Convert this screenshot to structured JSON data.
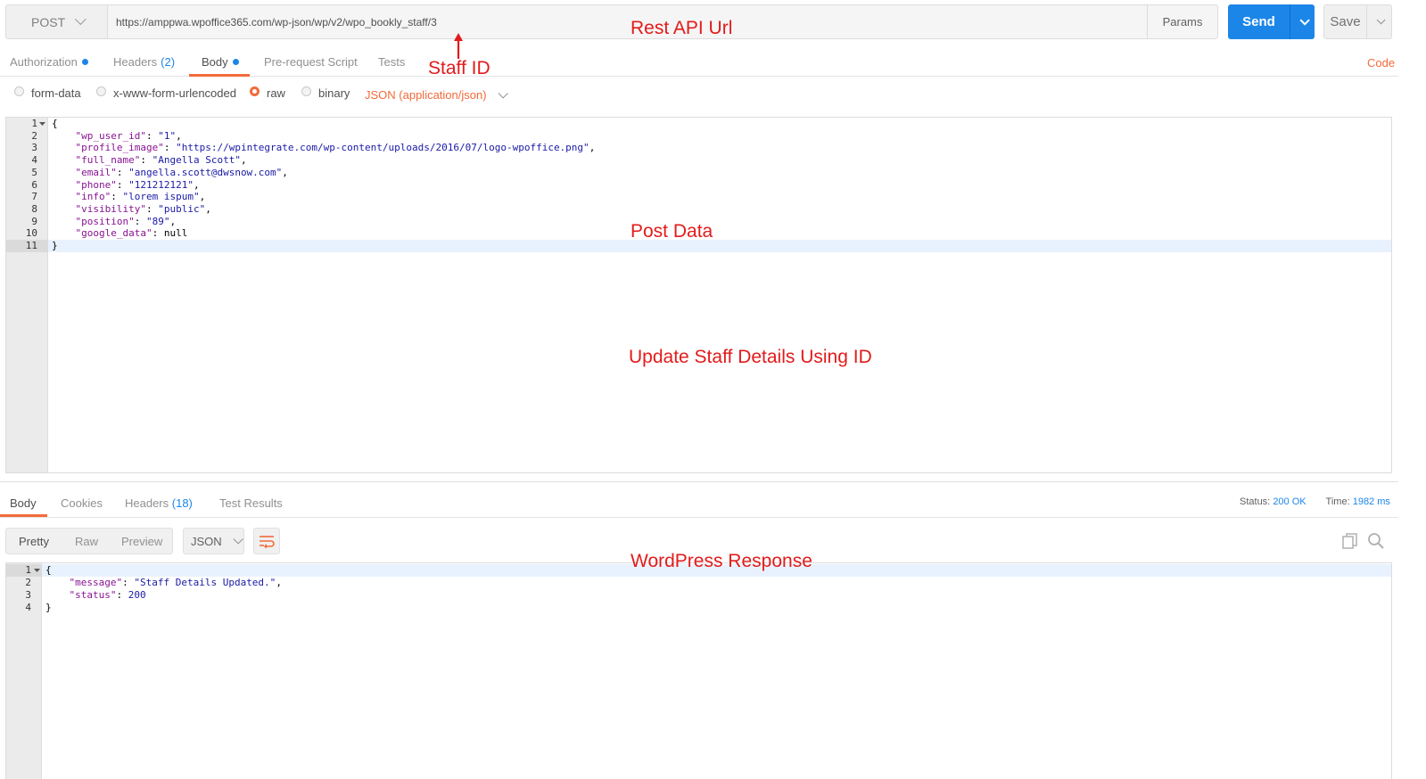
{
  "request": {
    "method": "POST",
    "url": "https://amppwa.wpoffice365.com/wp-json/wp/v2/wpo_bookly_staff/3",
    "params_label": "Params",
    "send_label": "Send",
    "save_label": "Save"
  },
  "annotations": {
    "rest_api_url": "Rest API Url",
    "staff_id": "Staff ID",
    "post_data": "Post Data",
    "update_staff": "Update Staff Details Using ID",
    "wordpress_response": "WordPress Response"
  },
  "request_tabs": {
    "authorization": "Authorization",
    "headers": "Headers",
    "headers_count": "(2)",
    "body": "Body",
    "pre_request": "Pre-request Script",
    "tests": "Tests",
    "code": "Code"
  },
  "body_types": {
    "form_data": "form-data",
    "urlencoded": "x-www-form-urlencoded",
    "raw": "raw",
    "binary": "binary",
    "selected": "raw",
    "content_type": "JSON (application/json)"
  },
  "request_body": {
    "line_numbers": [
      "1",
      "2",
      "3",
      "4",
      "5",
      "6",
      "7",
      "8",
      "9",
      "10",
      "11"
    ],
    "lines": [
      {
        "pre": "{",
        "key": "",
        "sep": "",
        "val": "",
        "post": ""
      },
      {
        "pre": "    ",
        "key": "\"wp_user_id\"",
        "sep": ": ",
        "val": "\"1\"",
        "post": ","
      },
      {
        "pre": "    ",
        "key": "\"profile_image\"",
        "sep": ": ",
        "val": "\"https://wpintegrate.com/wp-content/uploads/2016/07/logo-wpoffice.png\"",
        "post": ","
      },
      {
        "pre": "    ",
        "key": "\"full_name\"",
        "sep": ": ",
        "val": "\"Angella Scott\"",
        "post": ","
      },
      {
        "pre": "    ",
        "key": "\"email\"",
        "sep": ": ",
        "val": "\"angella.scott@dwsnow.com\"",
        "post": ","
      },
      {
        "pre": "    ",
        "key": "\"phone\"",
        "sep": ": ",
        "val": "\"121212121\"",
        "post": ","
      },
      {
        "pre": "    ",
        "key": "\"info\"",
        "sep": ": ",
        "val": "\"lorem ispum\"",
        "post": ","
      },
      {
        "pre": "    ",
        "key": "\"visibility\"",
        "sep": ": ",
        "val": "\"public\"",
        "post": ","
      },
      {
        "pre": "    ",
        "key": "\"position\"",
        "sep": ": ",
        "val": "\"89\"",
        "post": ","
      },
      {
        "pre": "    ",
        "key": "\"google_data\"",
        "sep": ": ",
        "val": "null",
        "post": ""
      },
      {
        "pre": "}",
        "key": "",
        "sep": "",
        "val": "",
        "post": ""
      }
    ]
  },
  "response_tabs": {
    "body": "Body",
    "cookies": "Cookies",
    "headers": "Headers",
    "headers_count": "(18)",
    "test_results": "Test Results",
    "status_label": "Status:",
    "status_value": "200 OK",
    "time_label": "Time:",
    "time_value": "1982 ms"
  },
  "response_view": {
    "pretty": "Pretty",
    "raw": "Raw",
    "preview": "Preview",
    "format": "JSON"
  },
  "response_body": {
    "line_numbers": [
      "1",
      "2",
      "3",
      "4"
    ],
    "lines": [
      {
        "pre": "{",
        "key": "",
        "sep": "",
        "val": "",
        "post": ""
      },
      {
        "pre": "    ",
        "key": "\"message\"",
        "sep": ": ",
        "val": "\"Staff Details Updated.\"",
        "post": ","
      },
      {
        "pre": "    ",
        "key": "\"status\"",
        "sep": ": ",
        "val": "200",
        "post": ""
      },
      {
        "pre": "}",
        "key": "",
        "sep": "",
        "val": "",
        "post": ""
      }
    ]
  },
  "colors": {
    "accent": "#f26b3a",
    "primary": "#1c86e8",
    "annotation": "#e21b1b"
  }
}
